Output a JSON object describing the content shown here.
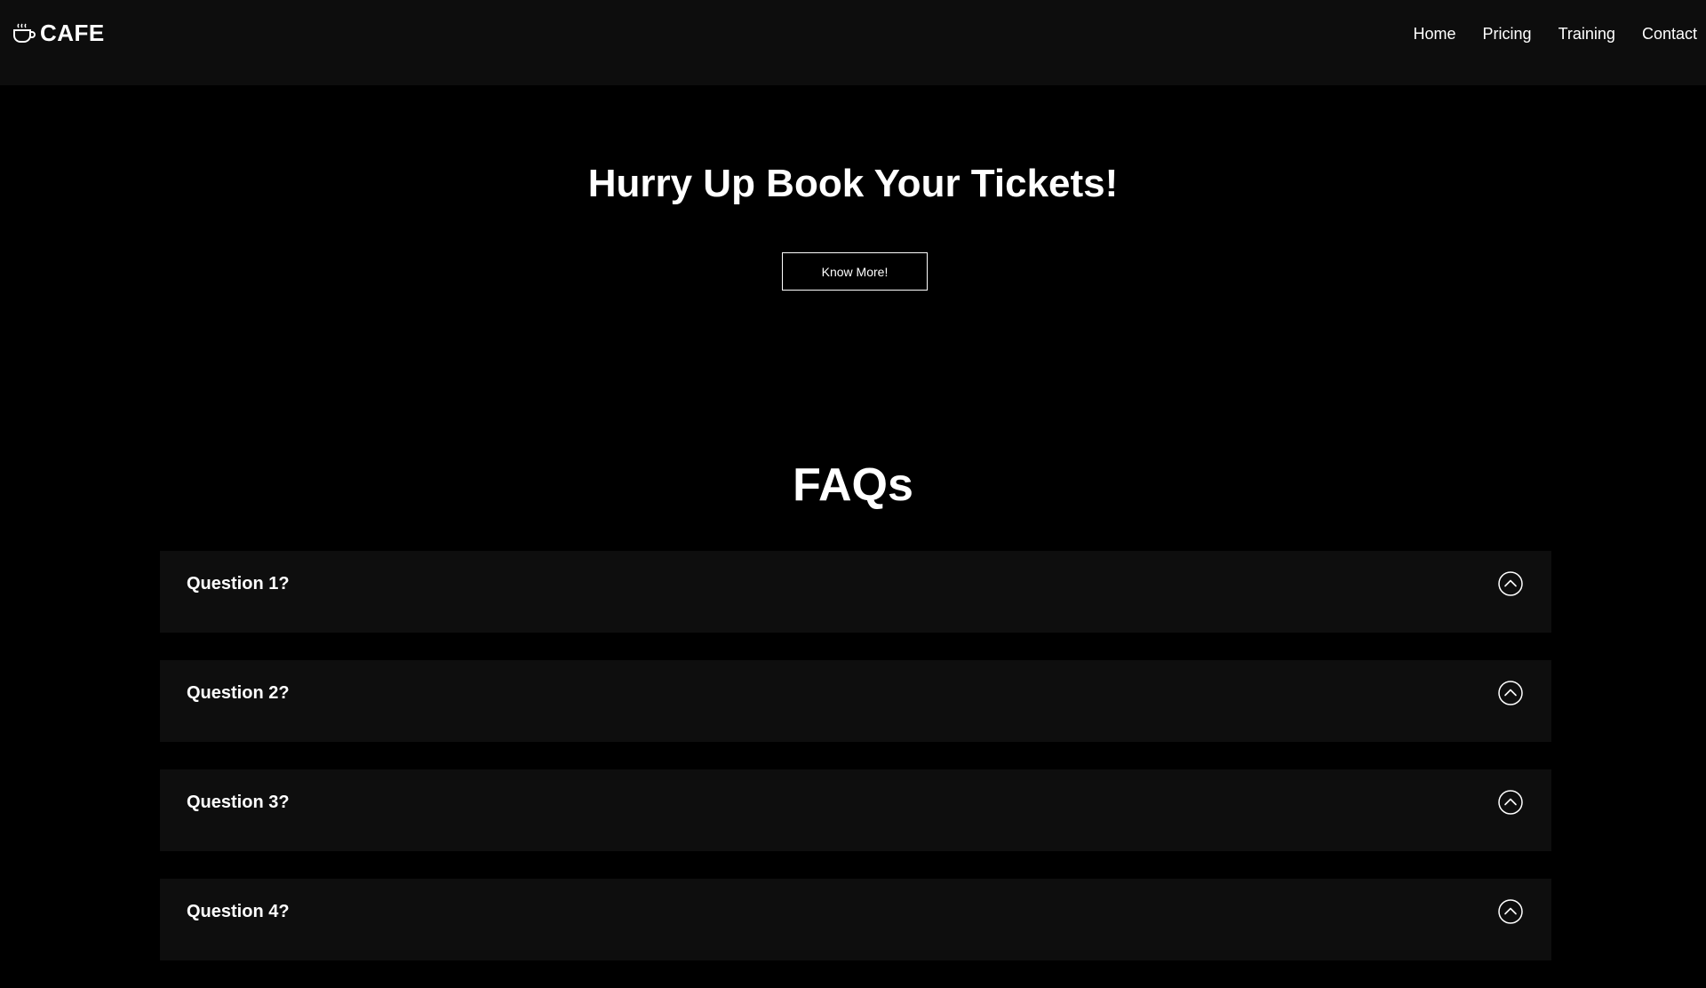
{
  "brand": {
    "name": "CAFE",
    "icon": "coffee-cup-icon"
  },
  "nav": {
    "items": [
      {
        "label": "Home"
      },
      {
        "label": "Pricing"
      },
      {
        "label": "Training"
      },
      {
        "label": "Contact"
      }
    ]
  },
  "hero": {
    "title": "Hurry Up Book Your Tickets!",
    "button_label": "Know More!"
  },
  "faq": {
    "title": "FAQs",
    "toggle_icon": "chevron-up-circle-icon",
    "items": [
      {
        "question": "Question 1?"
      },
      {
        "question": "Question 2?"
      },
      {
        "question": "Question 3?"
      },
      {
        "question": "Question 4?"
      }
    ]
  },
  "colors": {
    "background": "#000000",
    "navbar": "#0d0d0d",
    "card": "#0e0e0e",
    "text": "#ffffff"
  }
}
